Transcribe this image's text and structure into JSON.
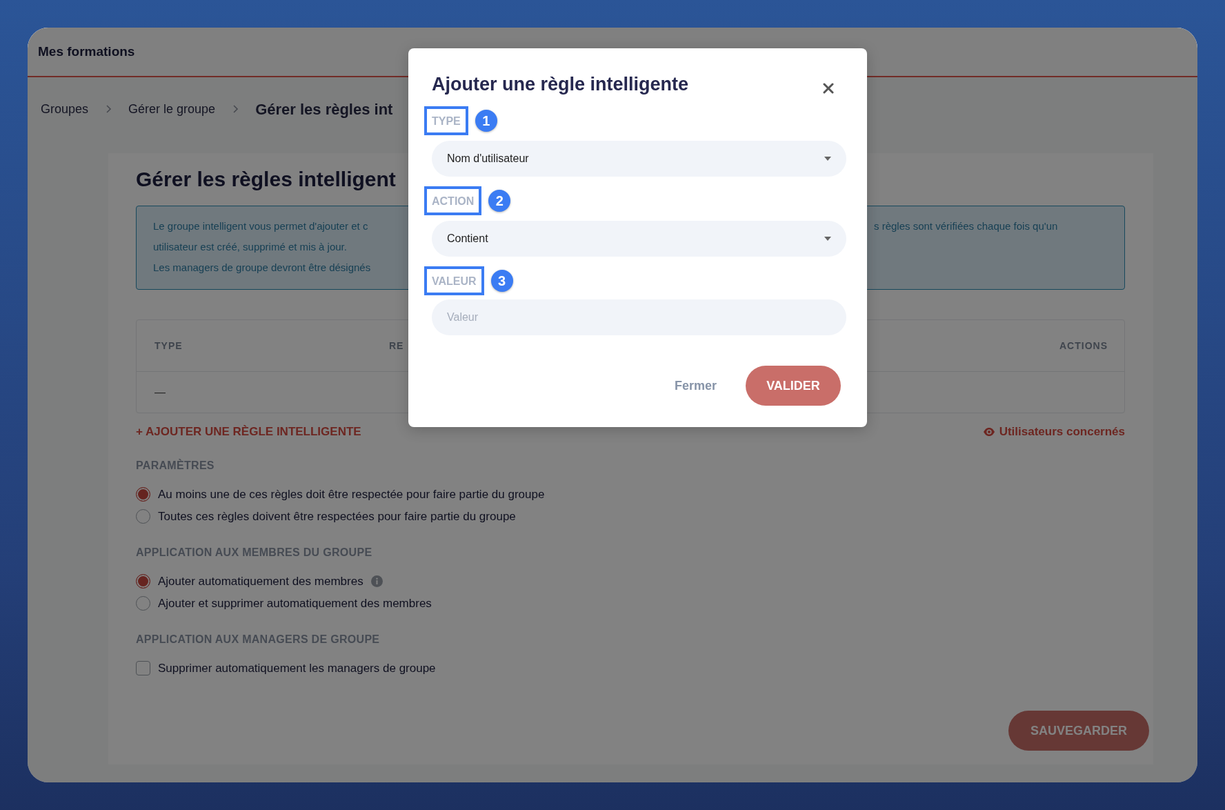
{
  "app": {
    "title": "Mes formations"
  },
  "breadcrumb": [
    {
      "label": "Groupes",
      "current": false
    },
    {
      "label": "Gérer le groupe",
      "current": false
    },
    {
      "label": "Gérer les règles int",
      "current": true
    }
  ],
  "page": {
    "heading": "Gérer les règles intelligent",
    "info_left": [
      "Le groupe intelligent vous permet d'ajouter et c",
      "utilisateur est créé, supprimé et mis à jour.",
      "Les managers de groupe devront être désignés"
    ],
    "info_right": "s règles sont vérifiées chaque fois qu'un",
    "table": {
      "columns": [
        "TYPE",
        "RE",
        "ACTIONS"
      ],
      "rows": [
        [
          "—"
        ]
      ]
    },
    "add_rule": "+ AJOUTER UNE RÈGLE INTELLIGENTE",
    "affected_users": "Utilisateurs concernés",
    "sections": [
      {
        "title": "PARAMÈTRES",
        "options": [
          {
            "kind": "radio",
            "label": "Au moins une de ces règles doit être respectée pour faire partie du groupe",
            "checked": true,
            "info": false
          },
          {
            "kind": "radio",
            "label": "Toutes ces règles doivent être respectées pour faire partie du groupe",
            "checked": false,
            "info": false
          }
        ]
      },
      {
        "title": "APPLICATION AUX MEMBRES DU GROUPE",
        "options": [
          {
            "kind": "radio",
            "label": "Ajouter automatiquement des membres",
            "checked": true,
            "info": true
          },
          {
            "kind": "radio",
            "label": "Ajouter et supprimer automatiquement des membres",
            "checked": false,
            "info": false
          }
        ]
      },
      {
        "title": "APPLICATION AUX MANAGERS DE GROUPE",
        "options": [
          {
            "kind": "checkbox",
            "label": "Supprimer automatiquement les managers de groupe",
            "checked": false,
            "info": false
          }
        ]
      }
    ],
    "save_button": "SAUVEGARDER"
  },
  "modal": {
    "title": "Ajouter une règle intelligente",
    "fields": [
      {
        "label": "TYPE",
        "step": "1",
        "kind": "select",
        "value": "Nom d'utilisateur"
      },
      {
        "label": "ACTION",
        "step": "2",
        "kind": "select",
        "value": "Contient"
      },
      {
        "label": "VALEUR",
        "step": "3",
        "kind": "text",
        "placeholder": "Valeur"
      }
    ],
    "close_button": "Fermer",
    "submit_button": "VALIDER"
  }
}
